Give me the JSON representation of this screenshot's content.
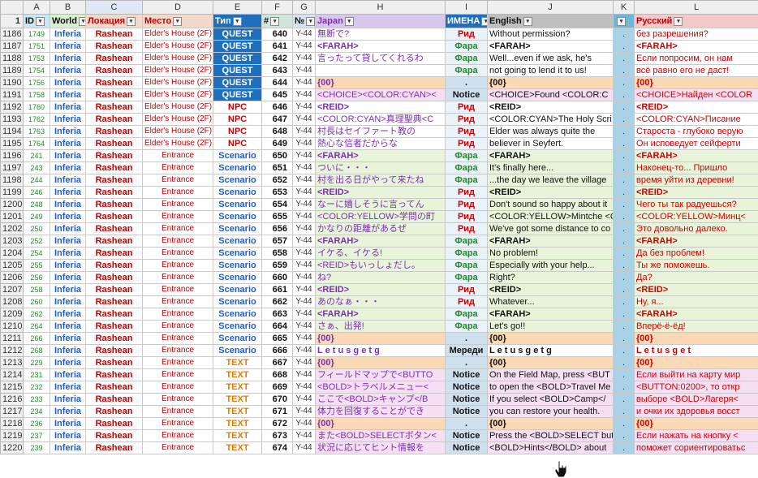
{
  "columns": [
    "",
    "A",
    "B",
    "C",
    "D",
    "E",
    "F",
    "G",
    "H",
    "I",
    "J",
    "K",
    "L"
  ],
  "header_row": {
    "rownum": "1",
    "A": "ID",
    "B": "World",
    "C": "Локация",
    "D": "Место",
    "E": "Тип",
    "F": "#",
    "G": "№",
    "H": "Japan",
    "I": "ИМЕНА",
    "J": "English",
    "K": "",
    "L": "Русский"
  },
  "rows": [
    {
      "r": "1186",
      "id": "1749",
      "world": "Inferia",
      "loc": "Rashean",
      "place": "Elder's House (2F)",
      "type": "QUEST",
      "tc": "t-quest",
      "num": "640",
      "ns": "Y-44",
      "jp": "無断で?",
      "name": "Рид",
      "nc": "red",
      "en": "Without permission?",
      "k": ".",
      "ru": "без разрешения?",
      "bg": "bg-white"
    },
    {
      "r": "1187",
      "id": "1751",
      "world": "Inferia",
      "loc": "Rashean",
      "place": "Elder's House (2F)",
      "type": "QUEST",
      "tc": "t-quest",
      "num": "641",
      "ns": "Y-44",
      "jp": "<FARAH>",
      "jpb": true,
      "name": "Фара",
      "nc": "",
      "en": "<FARAH>",
      "enb": true,
      "k": ".",
      "ru": "<FARAH>",
      "rub": true,
      "bg": "bg-white"
    },
    {
      "r": "1188",
      "id": "1753",
      "world": "Inferia",
      "loc": "Rashean",
      "place": "Elder's House (2F)",
      "type": "QUEST",
      "tc": "t-quest",
      "num": "642",
      "ns": "Y-44",
      "jp": "言ったって貸してくれるわ",
      "name": "Фара",
      "nc": "",
      "en": "Well...even if we ask, he's",
      "k": ".",
      "ru": "Если попросим, он нам",
      "bg": "bg-white"
    },
    {
      "r": "1189",
      "id": "1754",
      "world": "Inferia",
      "loc": "Rashean",
      "place": "Elder's House (2F)",
      "type": "QUEST",
      "tc": "t-quest",
      "num": "643",
      "ns": "Y-44",
      "jp": "",
      "name": "Фара",
      "nc": "",
      "en": "not going to lend it to us!",
      "k": ".",
      "ru": "всё равно его не даст!",
      "bg": "bg-white"
    },
    {
      "r": "1190",
      "id": "1756",
      "world": "Inferia",
      "loc": "Rashean",
      "place": "Elder's House (2F)",
      "type": "QUEST",
      "tc": "t-quest",
      "num": "644",
      "ns": "Y-44",
      "jp": "{00}",
      "jpb": true,
      "name": ".",
      "nc": "notice",
      "en": "{00}",
      "enb": true,
      "k": ".",
      "ru": "{00}",
      "rub": true,
      "bg": "bg-peach"
    },
    {
      "r": "1191",
      "id": "1758",
      "world": "Inferia",
      "loc": "Rashean",
      "place": "Elder's House (2F)",
      "type": "QUEST",
      "tc": "t-quest",
      "num": "645",
      "ns": "Y-44",
      "jp": "<CHOICE><COLOR:CYAN><",
      "name": "Notice",
      "nc": "notice",
      "en": "<CHOICE>Found <COLOR:C",
      "k": ".",
      "ru": "<CHOICE>Найден <COLOR",
      "bg": "bg-pink"
    },
    {
      "r": "1192",
      "id": "1760",
      "world": "Inferia",
      "loc": "Rashean",
      "place": "Elder's House (2F)",
      "type": "NPC",
      "tc": "t-npc",
      "num": "646",
      "ns": "Y-44",
      "jp": "<REID>",
      "jpb": true,
      "name": "Рид",
      "nc": "red",
      "en": "<REID>",
      "enb": true,
      "k": ".",
      "ru": "<REID>",
      "rub": true,
      "bg": "bg-white"
    },
    {
      "r": "1193",
      "id": "1762",
      "world": "Inferia",
      "loc": "Rashean",
      "place": "Elder's House (2F)",
      "type": "NPC",
      "tc": "t-npc",
      "num": "647",
      "ns": "Y-44",
      "jp": "<COLOR:CYAN>真理聖典<C",
      "name": "Рид",
      "nc": "red",
      "en": "<COLOR:CYAN>The Holy Scri",
      "k": ".",
      "ru": "<COLOR:CYAN>Писание",
      "bg": "bg-white"
    },
    {
      "r": "1194",
      "id": "1763",
      "world": "Inferia",
      "loc": "Rashean",
      "place": "Elder's House (2F)",
      "type": "NPC",
      "tc": "t-npc",
      "num": "648",
      "ns": "Y-44",
      "jp": "村長はセイファート教の",
      "name": "Рид",
      "nc": "red",
      "en": "Elder was always quite the",
      "k": ".",
      "ru": "Староста - глубоко верую",
      "bg": "bg-white"
    },
    {
      "r": "1195",
      "id": "1764",
      "world": "Inferia",
      "loc": "Rashean",
      "place": "Elder's House (2F)",
      "type": "NPC",
      "tc": "t-npc",
      "num": "649",
      "ns": "Y-44",
      "jp": "熱心な信者だからな",
      "name": "Рид",
      "nc": "red",
      "en": "believer in Seyfert.",
      "k": ".",
      "ru": "Он исповедует сейферти",
      "bg": "bg-white"
    },
    {
      "r": "1196",
      "id": "241",
      "world": "Inferia",
      "loc": "Rashean",
      "place": "Entrance",
      "type": "Scenario",
      "tc": "t-scen",
      "num": "650",
      "ns": "Y-44",
      "jp": "<FARAH>",
      "jpb": true,
      "name": "Фара",
      "nc": "",
      "en": "<FARAH>",
      "enb": true,
      "k": ".",
      "ru": "<FARAH>",
      "rub": true,
      "bg": "bg-green"
    },
    {
      "r": "1197",
      "id": "243",
      "world": "Inferia",
      "loc": "Rashean",
      "place": "Entrance",
      "type": "Scenario",
      "tc": "t-scen",
      "num": "651",
      "ns": "Y-44",
      "jp": "ついに・・・",
      "name": "Фара",
      "nc": "",
      "en": "It's finally here...",
      "k": ".",
      "ru": "Наконец-то... Пришло",
      "bg": "bg-green"
    },
    {
      "r": "1198",
      "id": "244",
      "world": "Inferia",
      "loc": "Rashean",
      "place": "Entrance",
      "type": "Scenario",
      "tc": "t-scen",
      "num": "652",
      "ns": "Y-44",
      "jp": "村を出る日がやって来たね",
      "name": "Фара",
      "nc": "",
      "en": "...the day we leave the village",
      "k": ".",
      "ru": "время уйти из деревни!",
      "bg": "bg-green"
    },
    {
      "r": "1199",
      "id": "246",
      "world": "Inferia",
      "loc": "Rashean",
      "place": "Entrance",
      "type": "Scenario",
      "tc": "t-scen",
      "num": "653",
      "ns": "Y-44",
      "jp": "<REID>",
      "jpb": true,
      "name": "Рид",
      "nc": "red",
      "en": "<REID>",
      "enb": true,
      "k": ".",
      "ru": "<REID>",
      "rub": true,
      "bg": "bg-green"
    },
    {
      "r": "1200",
      "id": "248",
      "world": "Inferia",
      "loc": "Rashean",
      "place": "Entrance",
      "type": "Scenario",
      "tc": "t-scen",
      "num": "654",
      "ns": "Y-44",
      "jp": "なーに嬉しそうに言ってん",
      "name": "Рид",
      "nc": "red",
      "en": "Don't sound so happy about it",
      "k": ".",
      "ru": "Чего ты так радуешься?",
      "bg": "bg-green"
    },
    {
      "r": "1201",
      "id": "249",
      "world": "Inferia",
      "loc": "Rashean",
      "place": "Entrance",
      "type": "Scenario",
      "tc": "t-scen",
      "num": "655",
      "ns": "Y-44",
      "jp": "<COLOR:YELLOW>学問の町",
      "name": "Рид",
      "nc": "red",
      "en": "<COLOR:YELLOW>Mintche <C",
      "k": ".",
      "ru": "<COLOR:YELLOW>Минц<",
      "bg": "bg-green"
    },
    {
      "r": "1202",
      "id": "250",
      "world": "Inferia",
      "loc": "Rashean",
      "place": "Entrance",
      "type": "Scenario",
      "tc": "t-scen",
      "num": "656",
      "ns": "Y-44",
      "jp": "かなりの距離があるぜ",
      "name": "Рид",
      "nc": "red",
      "en": "We've got some distance to co",
      "k": ".",
      "ru": "Это довольно далеко.",
      "bg": "bg-green"
    },
    {
      "r": "1203",
      "id": "252",
      "world": "Inferia",
      "loc": "Rashean",
      "place": "Entrance",
      "type": "Scenario",
      "tc": "t-scen",
      "num": "657",
      "ns": "Y-44",
      "jp": "<FARAH>",
      "jpb": true,
      "name": "Фара",
      "nc": "",
      "en": "<FARAH>",
      "enb": true,
      "k": ".",
      "ru": "<FARAH>",
      "rub": true,
      "bg": "bg-green"
    },
    {
      "r": "1204",
      "id": "254",
      "world": "Inferia",
      "loc": "Rashean",
      "place": "Entrance",
      "type": "Scenario",
      "tc": "t-scen",
      "num": "658",
      "ns": "Y-44",
      "jp": "イケる、イケる!",
      "name": "Фара",
      "nc": "",
      "en": "No problem!",
      "k": ".",
      "ru": "Да без проблем!",
      "bg": "bg-green"
    },
    {
      "r": "1205",
      "id": "255",
      "world": "Inferia",
      "loc": "Rashean",
      "place": "Entrance",
      "type": "Scenario",
      "tc": "t-scen",
      "num": "659",
      "ns": "Y-44",
      "jp": "<REID>もいっしょだし。",
      "name": "Фара",
      "nc": "",
      "en": "Especially with your help...",
      "k": ".",
      "ru": "Ты же поможешь.",
      "bg": "bg-green"
    },
    {
      "r": "1206",
      "id": "256",
      "world": "Inferia",
      "loc": "Rashean",
      "place": "Entrance",
      "type": "Scenario",
      "tc": "t-scen",
      "num": "660",
      "ns": "Y-44",
      "jp": "ね?",
      "name": "Фара",
      "nc": "",
      "en": "Right?",
      "k": ".",
      "ru": "Да?",
      "bg": "bg-green"
    },
    {
      "r": "1207",
      "id": "258",
      "world": "Inferia",
      "loc": "Rashean",
      "place": "Entrance",
      "type": "Scenario",
      "tc": "t-scen",
      "num": "661",
      "ns": "Y-44",
      "jp": "<REID>",
      "jpb": true,
      "name": "Рид",
      "nc": "red",
      "en": "<REID>",
      "enb": true,
      "k": ".",
      "ru": "<REID>",
      "rub": true,
      "bg": "bg-green"
    },
    {
      "r": "1208",
      "id": "260",
      "world": "Inferia",
      "loc": "Rashean",
      "place": "Entrance",
      "type": "Scenario",
      "tc": "t-scen",
      "num": "662",
      "ns": "Y-44",
      "jp": "あのなぁ・・・",
      "name": "Рид",
      "nc": "red",
      "en": "Whatever...",
      "k": ".",
      "ru": "Ну, я...",
      "bg": "bg-green"
    },
    {
      "r": "1209",
      "id": "262",
      "world": "Inferia",
      "loc": "Rashean",
      "place": "Entrance",
      "type": "Scenario",
      "tc": "t-scen",
      "num": "663",
      "ns": "Y-44",
      "jp": "<FARAH>",
      "jpb": true,
      "name": "Фара",
      "nc": "",
      "en": "<FARAH>",
      "enb": true,
      "k": ".",
      "ru": "<FARAH>",
      "rub": true,
      "bg": "bg-green"
    },
    {
      "r": "1210",
      "id": "264",
      "world": "Inferia",
      "loc": "Rashean",
      "place": "Entrance",
      "type": "Scenario",
      "tc": "t-scen",
      "num": "664",
      "ns": "Y-44",
      "jp": "さぁ、出発!",
      "name": "Фара",
      "nc": "",
      "en": "Let's go!!",
      "k": ".",
      "ru": "Вперё-ё-ёд!",
      "bg": "bg-green"
    },
    {
      "r": "1211",
      "id": "266",
      "world": "Inferia",
      "loc": "Rashean",
      "place": "Entrance",
      "type": "Scenario",
      "tc": "t-scen",
      "num": "665",
      "ns": "Y-44",
      "jp": "{00}",
      "jpb": true,
      "name": ".",
      "nc": "notice",
      "en": "{00}",
      "enb": true,
      "k": ".",
      "ru": "{00}",
      "rub": true,
      "bg": "bg-peach"
    },
    {
      "r": "1212",
      "id": "268",
      "world": "Inferia",
      "loc": "Rashean",
      "place": "Entrance",
      "type": "Scenario",
      "tc": "t-scen",
      "num": "666",
      "ns": "Y-44",
      "jp": "L e t   u s   g e t   g",
      "jpb": true,
      "name": "Мереди",
      "nc": "notice",
      "en": "L e t   u s   g e t   g",
      "enb": true,
      "k": ".",
      "ru": "L e t   u s   g e t",
      "rub": true,
      "bg": "bg-white"
    },
    {
      "r": "1213",
      "id": "229",
      "world": "Inferia",
      "loc": "Rashean",
      "place": "Entrance",
      "type": "TEXT",
      "tc": "t-text",
      "num": "667",
      "ns": "Y-44",
      "jp": "{00}",
      "jpb": true,
      "name": ".",
      "nc": "notice",
      "en": "{00}",
      "enb": true,
      "k": ".",
      "ru": "{00}",
      "rub": true,
      "bg": "bg-peach"
    },
    {
      "r": "1214",
      "id": "231",
      "world": "Inferia",
      "loc": "Rashean",
      "place": "Entrance",
      "type": "TEXT",
      "tc": "t-text",
      "num": "668",
      "ns": "Y-44",
      "jp": "フィールドマップで<BUTTO",
      "name": "Notice",
      "nc": "notice",
      "en": "On the Field Map, press <BUT",
      "k": ".",
      "ru": "Если выйти на карту мир",
      "bg": "bg-pink"
    },
    {
      "r": "1215",
      "id": "232",
      "world": "Inferia",
      "loc": "Rashean",
      "place": "Entrance",
      "type": "TEXT",
      "tc": "t-text",
      "num": "669",
      "ns": "Y-44",
      "jp": "<BOLD>トラベルメニュー<",
      "name": "Notice",
      "nc": "notice",
      "en": "to open the <BOLD>Travel Me",
      "k": ".",
      "ru": "<BUTTON:0200>, то откр",
      "bg": "bg-pink"
    },
    {
      "r": "1216",
      "id": "233",
      "world": "Inferia",
      "loc": "Rashean",
      "place": "Entrance",
      "type": "TEXT",
      "tc": "t-text",
      "num": "670",
      "ns": "Y-44",
      "jp": "ここで<BOLD>キャンプ</B",
      "name": "Notice",
      "nc": "notice",
      "en": "If you select <BOLD>Camp</",
      "k": ".",
      "ru": "выборе <BOLD>Лагеря<",
      "bg": "bg-pink"
    },
    {
      "r": "1217",
      "id": "234",
      "world": "Inferia",
      "loc": "Rashean",
      "place": "Entrance",
      "type": "TEXT",
      "tc": "t-text",
      "num": "671",
      "ns": "Y-44",
      "jp": "体力を回復することができ",
      "name": "Notice",
      "nc": "notice",
      "en": "you can restore your health.",
      "k": ".",
      "ru": "и очки их здоровья восст",
      "bg": "bg-pink"
    },
    {
      "r": "1218",
      "id": "236",
      "world": "Inferia",
      "loc": "Rashean",
      "place": "Entrance",
      "type": "TEXT",
      "tc": "t-text",
      "num": "672",
      "ns": "Y-44",
      "jp": "{00}",
      "jpb": true,
      "name": ".",
      "nc": "notice",
      "en": "{00}",
      "enb": true,
      "k": ".",
      "ru": "{00}",
      "rub": true,
      "bg": "bg-peach"
    },
    {
      "r": "1219",
      "id": "237",
      "world": "Inferia",
      "loc": "Rashean",
      "place": "Entrance",
      "type": "TEXT",
      "tc": "t-text",
      "num": "673",
      "ns": "Y-44",
      "jp": "また<BOLD>SELECTボタン<",
      "name": "Notice",
      "nc": "notice",
      "en": "Press the <BOLD>SELECT but",
      "k": ".",
      "ru": "Если нажать на кнопку <",
      "bg": "bg-pink"
    },
    {
      "r": "1220",
      "id": "239",
      "world": "Inferia",
      "loc": "Rashean",
      "place": "Entrance",
      "type": "TEXT",
      "tc": "t-text",
      "num": "674",
      "ns": "Y-44",
      "jp": "状況に応じてヒント情報を",
      "name": "Notice",
      "nc": "notice",
      "en": "<BOLD>Hints</BOLD> about",
      "k": ".",
      "ru": "поможет сориентироватьс",
      "bg": "bg-pink"
    }
  ]
}
